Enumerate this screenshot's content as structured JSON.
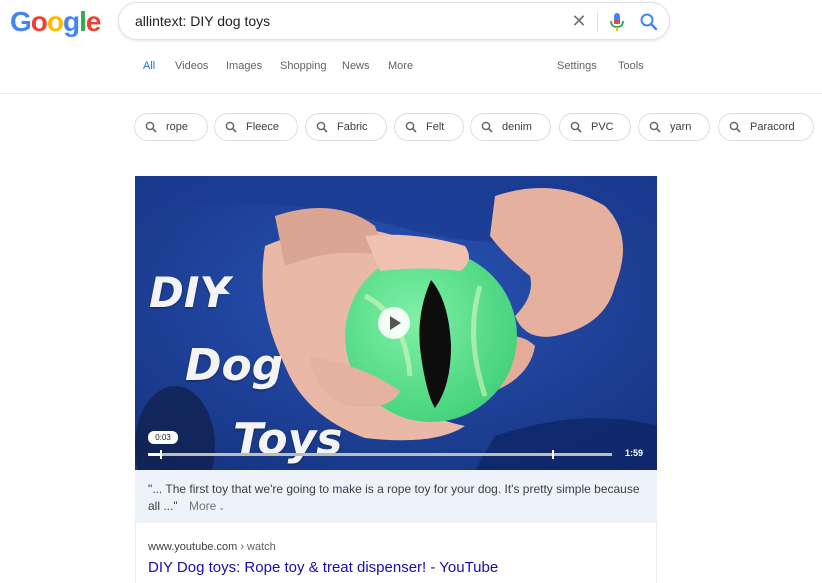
{
  "logo": {
    "letters": [
      "G",
      "o",
      "o",
      "g",
      "l",
      "e"
    ],
    "colors": [
      "#4285f4",
      "#ea4335",
      "#fbbc05",
      "#4285f4",
      "#34a853",
      "#ea4335"
    ]
  },
  "search": {
    "query": "allintext: DIY dog toys"
  },
  "tabs": [
    {
      "label": "All",
      "active": true
    },
    {
      "label": "Videos"
    },
    {
      "label": "Images"
    },
    {
      "label": "Shopping"
    },
    {
      "label": "News"
    },
    {
      "label": "More"
    },
    {
      "label": "Settings"
    },
    {
      "label": "Tools"
    }
  ],
  "chips": [
    "rope",
    "Fleece",
    "Fabric",
    "Felt",
    "denim",
    "PVC",
    "yarn",
    "Paracord"
  ],
  "video": {
    "title_lines": [
      "DIY",
      "Dog",
      "Toys"
    ],
    "current_time": "0:03",
    "duration": "1:59",
    "progress_fraction": 0.025
  },
  "transcript": {
    "text": "\"... The first toy that we're going to make is a rope toy for your dog. It's pretty simple because all ...\"",
    "more_label": "More"
  },
  "result": {
    "site": "www.youtube.com",
    "breadcrumb": " › watch",
    "title": "DIY Dog toys: Rope toy & treat dispenser! - YouTube"
  },
  "colors": {
    "accent": "#1a73e8",
    "link": "#1a0dab",
    "video_bg": "#1d3c8c",
    "ball": "#53e38a"
  }
}
